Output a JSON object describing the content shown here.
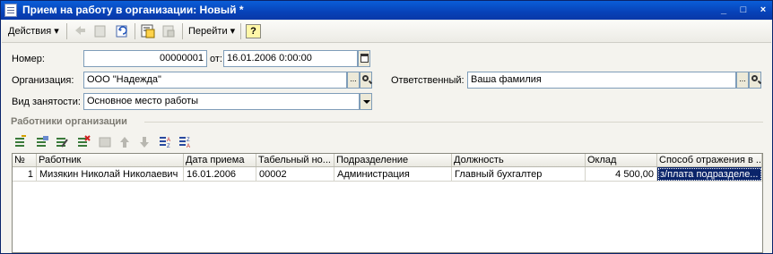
{
  "window": {
    "title": "Прием на работу в организации: Новый *",
    "controls": [
      "_",
      "□",
      "×"
    ]
  },
  "toolbar": {
    "actions_label": "Действия",
    "goto_label": "Перейти",
    "help_label": "?",
    "icons": [
      "back-arrow-icon",
      "document-icon",
      "refresh-icon",
      "post-document-icon",
      "print-icon"
    ]
  },
  "form": {
    "number_label": "Номер:",
    "number_value": "00000001",
    "date_label": "от:",
    "date_value": "16.01.2006  0:00:00",
    "org_label": "Организация:",
    "org_value": "ООО \"Надежда\"",
    "responsible_label": "Ответственный:",
    "responsible_value": "Ваша фамилия",
    "employment_label": "Вид занятости:",
    "employment_value": "Основное место работы",
    "select_button": "..."
  },
  "section": {
    "title": "Работники организации",
    "icons": [
      "add-row-icon",
      "copy-row-icon",
      "edit-row-icon",
      "delete-row-icon",
      "end-edit-icon",
      "move-up-icon",
      "move-down-icon",
      "sort-asc-icon",
      "sort-desc-icon"
    ]
  },
  "table": {
    "columns": [
      "№",
      "Работник",
      "Дата приема",
      "Табельный но...",
      "Подразделение",
      "Должность",
      "Оклад",
      "Способ отражения в ..."
    ],
    "rows": [
      {
        "n": "1",
        "employee": "Мизякин Николай Николаевич",
        "hire_date": "16.01.2006",
        "tab_number": "00002",
        "department": "Администрация",
        "position": "Главный бухгалтер",
        "salary": "4 500,00",
        "method": "з/плата подразделе..."
      }
    ]
  },
  "colors": {
    "titlebar": "#0742b8",
    "selection": "#0a246a",
    "window_bg": "#f4f3ee"
  }
}
